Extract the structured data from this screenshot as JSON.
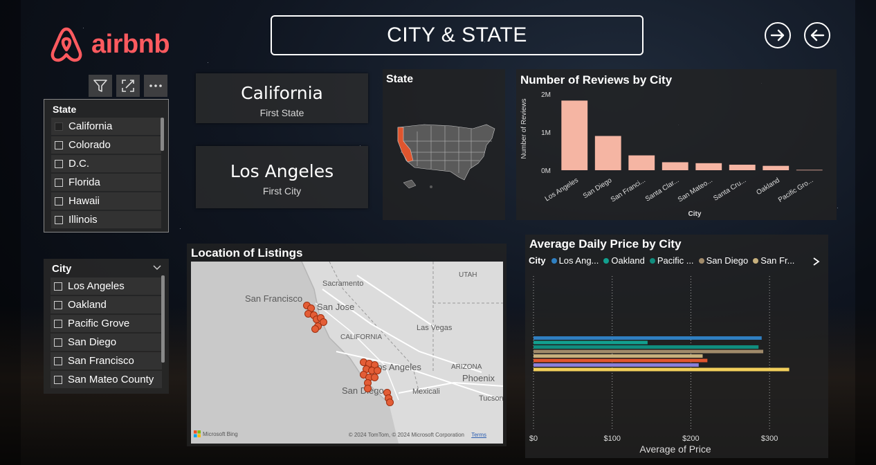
{
  "title": "CITY & STATE",
  "brand": {
    "name": "airbnb",
    "color": "#ff5a5f"
  },
  "nav": {
    "forward_icon": "arrow-right-icon",
    "back_icon": "arrow-left-icon"
  },
  "toolbar": {
    "icons": [
      "filter-icon",
      "focus-mode-icon",
      "more-options-icon"
    ]
  },
  "state_slicer": {
    "header": "State",
    "items": [
      {
        "label": "California",
        "checked": true
      },
      {
        "label": "Colorado",
        "checked": false
      },
      {
        "label": "D.C.",
        "checked": false
      },
      {
        "label": "Florida",
        "checked": false
      },
      {
        "label": "Hawaii",
        "checked": false
      },
      {
        "label": "Illinois",
        "checked": false
      }
    ]
  },
  "city_slicer": {
    "header": "City",
    "items": [
      {
        "label": "Los Angeles"
      },
      {
        "label": "Oakland"
      },
      {
        "label": "Pacific Grove"
      },
      {
        "label": "San Diego"
      },
      {
        "label": "San Francisco"
      },
      {
        "label": "San Mateo County"
      }
    ]
  },
  "cards": {
    "state": {
      "value": "California",
      "label": "First State"
    },
    "city": {
      "value": "Los Angeles",
      "label": "First City"
    }
  },
  "state_map": {
    "title": "State",
    "highlight_color": "#e0552e",
    "base_color": "#5a5a5a"
  },
  "listing_map": {
    "title": "Location of Listings",
    "labels": {
      "sacramento": "Sacramento",
      "utah": "UTAH",
      "san_francisco": "San Francisco",
      "san_jose": "San Jose",
      "las_vegas": "Las Vegas",
      "california": "CALIFORNIA",
      "los_angeles": "Los Angeles",
      "arizona": "ARIZONA",
      "phoenix": "Phoenix",
      "san_diego": "San Diego",
      "mexicali": "Mexicali",
      "tucson": "Tucson"
    },
    "attribution": "© 2024 TomTom, © 2024 Microsoft Corporation",
    "terms": "Terms",
    "bing": "Microsoft Bing",
    "dot_color": "#e35d36"
  },
  "chart_data": [
    {
      "type": "bar",
      "title": "Number of Reviews by City",
      "xlabel": "City",
      "ylabel": "Number of Reviews",
      "categories": [
        "Los Angeles",
        "San Diego",
        "San Franci...",
        "Santa Clar...",
        "San Mateo...",
        "Santa Cru...",
        "Oakland",
        "Pacific Gro..."
      ],
      "values": [
        1830000,
        900000,
        390000,
        210000,
        185000,
        145000,
        115000,
        10000
      ],
      "yticks": [
        "0M",
        "1M",
        "2M"
      ],
      "ylim": [
        0,
        2000000
      ],
      "color": "#f5b5a3"
    },
    {
      "type": "bar",
      "orientation": "horizontal",
      "title": "Average Daily Price by City",
      "xlabel": "Average of Price",
      "legend_title": "City",
      "legend": [
        {
          "name": "Los Ang...",
          "color": "#2f7fc1"
        },
        {
          "name": "Oakland",
          "color": "#12a08f"
        },
        {
          "name": "Pacific ...",
          "color": "#118c7e"
        },
        {
          "name": "San Diego",
          "color": "#a08a6a"
        },
        {
          "name": "San Fr...",
          "color": "#c7b07d"
        }
      ],
      "xticks": [
        "$0",
        "$100",
        "$200",
        "$300"
      ],
      "xlim": [
        0,
        350
      ],
      "series": [
        {
          "color": "#2f7fc1",
          "value": 290
        },
        {
          "color": "#12a08f",
          "value": 145
        },
        {
          "color": "#118c7e",
          "value": 286
        },
        {
          "color": "#a08a6a",
          "value": 292
        },
        {
          "color": "#c7b07d",
          "value": 215
        },
        {
          "color": "#e0552e",
          "value": 221
        },
        {
          "color": "#8a7fd8",
          "value": 210
        },
        {
          "color": "#f2cf5b",
          "value": 325
        }
      ]
    }
  ]
}
